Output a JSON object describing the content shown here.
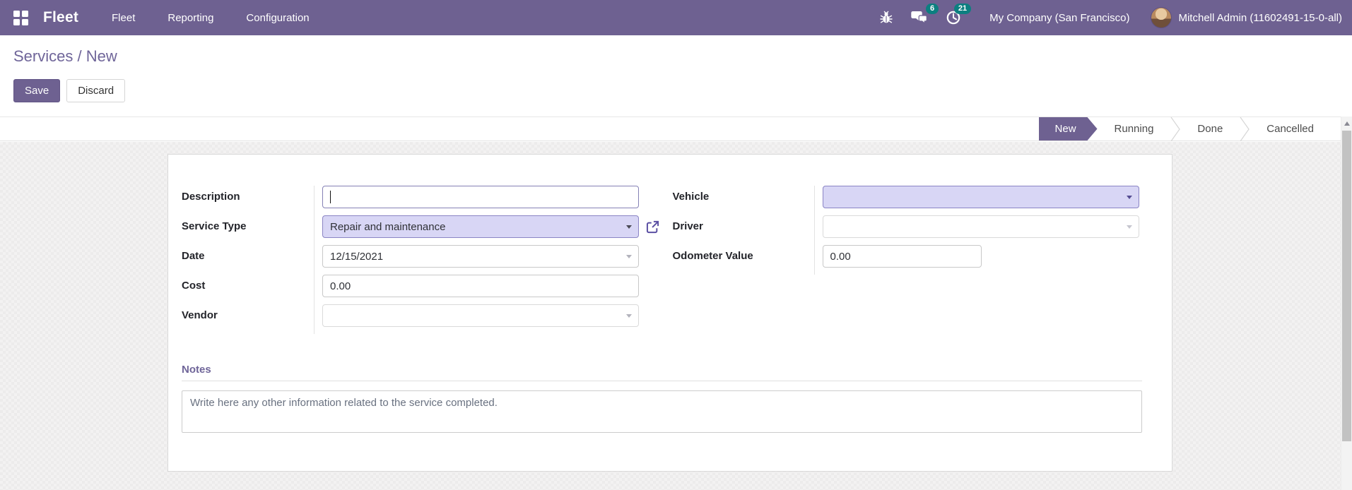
{
  "header": {
    "brand": "Fleet",
    "menu": {
      "fleet": "Fleet",
      "reporting": "Reporting",
      "configuration": "Configuration"
    },
    "systray": {
      "messages_badge": "6",
      "activities_badge": "21",
      "company": "My Company (San Francisco)",
      "user": "Mitchell Admin (11602491-15-0-all)"
    }
  },
  "breadcrumb": {
    "parent": "Services",
    "separator": " / ",
    "current": "New"
  },
  "actions": {
    "save": "Save",
    "discard": "Discard"
  },
  "statusbar": {
    "active": "New",
    "states": [
      {
        "label": "New"
      },
      {
        "label": "Running"
      },
      {
        "label": "Done"
      },
      {
        "label": "Cancelled"
      }
    ]
  },
  "form": {
    "description": {
      "label": "Description",
      "value": ""
    },
    "service_type": {
      "label": "Service Type",
      "value": "Repair and maintenance"
    },
    "date": {
      "label": "Date",
      "value": "12/15/2021"
    },
    "cost": {
      "label": "Cost",
      "value": "0.00"
    },
    "vendor": {
      "label": "Vendor",
      "value": ""
    },
    "vehicle": {
      "label": "Vehicle",
      "value": ""
    },
    "driver": {
      "label": "Driver",
      "value": ""
    },
    "odometer": {
      "label": "Odometer Value",
      "value": "0.00"
    },
    "notes": {
      "title": "Notes",
      "placeholder": "Write here any other information related to the service completed."
    }
  },
  "colors": {
    "header_bg": "#6e6191",
    "badge": "#0c7f80",
    "accent": "#6f6599",
    "highlight_field_bg": "#d8d6f5",
    "active_state_bg": "#6e6191"
  }
}
